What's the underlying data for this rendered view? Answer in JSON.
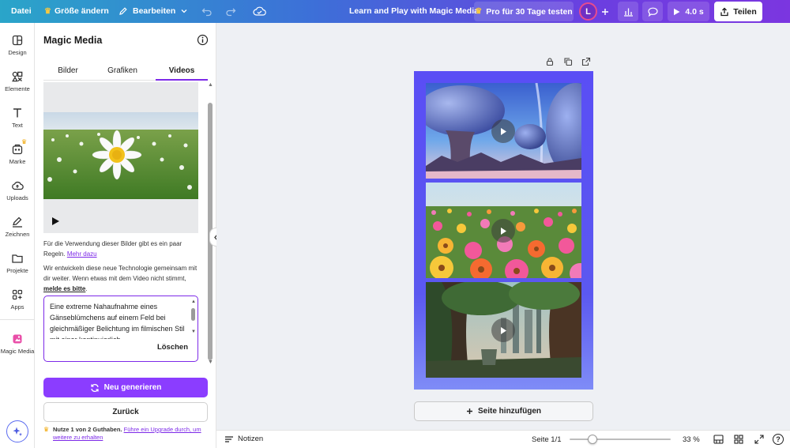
{
  "topbar": {
    "file": "Datei",
    "resize": "Größe ändern",
    "edit": "Bearbeiten",
    "doc_title": "Learn and Play with Magic Media",
    "pro_trial": "Pro für 30 Tage testen",
    "avatar_initial": "L",
    "duration": "4.0 s",
    "share": "Teilen"
  },
  "rail": [
    {
      "label": "Design",
      "icon": "layout-icon"
    },
    {
      "label": "Elemente",
      "icon": "elements-icon"
    },
    {
      "label": "Text",
      "icon": "text-icon"
    },
    {
      "label": "Marke",
      "icon": "brand-icon"
    },
    {
      "label": "Uploads",
      "icon": "cloud-upload-icon"
    },
    {
      "label": "Zeichnen",
      "icon": "pen-icon"
    },
    {
      "label": "Projekte",
      "icon": "folder-icon"
    },
    {
      "label": "Apps",
      "icon": "apps-icon"
    },
    {
      "label": "Magic Media",
      "icon": "magic-media-icon"
    }
  ],
  "panel": {
    "title": "Magic Media",
    "tabs": [
      "Bilder",
      "Grafiken",
      "Videos"
    ],
    "active_tab": "Videos",
    "rules_text": "Für die Verwendung dieser Bilder gibt es ein paar Regeln.",
    "rules_link": "Mehr dazu",
    "feedback_text": "Wir entwickeln diese neue Technologie gemeinsam mit dir weiter. Wenn etwas mit dem Video nicht stimmt,",
    "feedback_link": "melde es bitte",
    "prompt_text": "Eine extreme Nahaufnahme eines Gänseblümchens auf einem Feld bei gleichmäßiger Belichtung im filmischen Stil mit einer kontinuierlich",
    "delete": "Löschen",
    "regenerate": "Neu generieren",
    "back": "Zurück",
    "credits_text": "Nutze 1 von 2 Guthaben.",
    "credits_link": "Führe ein Upgrade durch, um weitere zu erhalten"
  },
  "canvas": {
    "add_page": "Seite hinzufügen"
  },
  "bottombar": {
    "notes": "Notizen",
    "page": "Seite 1/1",
    "zoom": "33 %",
    "zoom_level": 0.33
  },
  "colors": {
    "accent": "#8b3dff",
    "link": "#7d2ae8"
  }
}
